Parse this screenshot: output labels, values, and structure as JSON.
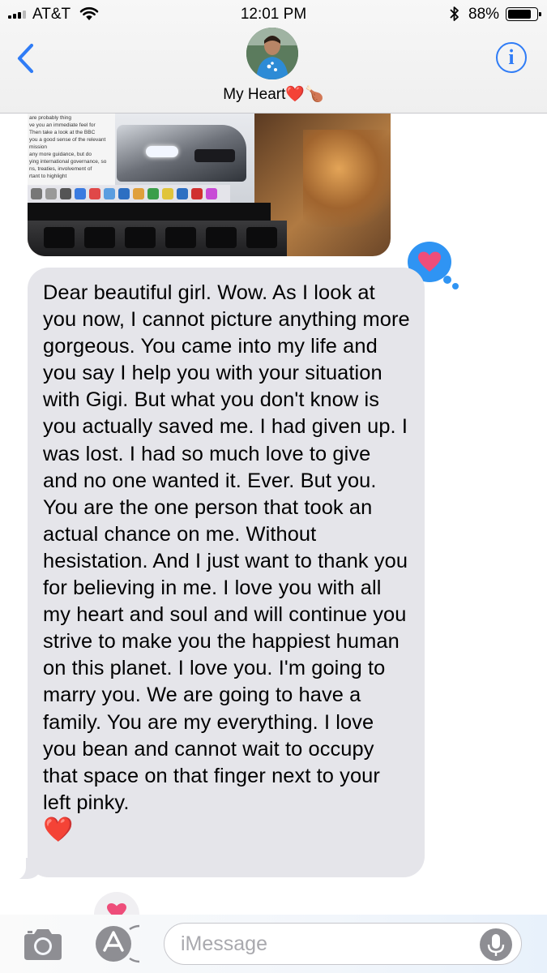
{
  "status_bar": {
    "carrier": "AT&T",
    "time": "12:01 PM",
    "battery_percent": "88%",
    "battery_level": 0.88,
    "signal_bars_filled": 3,
    "signal_bars_total": 4
  },
  "nav": {
    "contact_name": "My Heart",
    "contact_name_emoji": "❤️🍗",
    "back_icon": "chevron-left-icon",
    "info_icon": "info-icon"
  },
  "conversation": {
    "message_text": "Dear beautiful girl. Wow. As I look at you now, I cannot picture anything more gorgeous. You came into my life and you say I help you with your situation with Gigi. But what you don't know is you actually saved me. I had given up. I was lost. I had so much love to give and no one wanted it. Ever. But you. You are the one person that took an actual chance on me. Without hesistation. And I just want to thank you for believing in me. I love you with all my heart and soul and will continue you strive to make you the happiest human on this planet. I love you. I'm going to marry you. We are going to have a family. You are my everything. I love you bean and cannot wait to occupy that space on that finger next to your left pinky.",
    "message_emoji": "❤️",
    "photo_doc_text": [
      "are probably thing",
      "ve you an immediate feel for",
      "Then take a look at the BBC",
      "you a good sense of the relevant",
      "mission",
      "any more guidance, but do",
      "ying international governance, so",
      "ns, treaties, involvement of",
      "rtant to highlight"
    ],
    "tapback_icon": "heart-icon"
  },
  "input_bar": {
    "placeholder": "iMessage",
    "camera_icon": "camera-icon",
    "appstore_icon": "app-store-icon",
    "mic_icon": "microphone-icon"
  },
  "colors": {
    "accent_blue": "#2f7cf6",
    "tapback_blue": "#2f94f3",
    "heart_pink": "#ee4d7a",
    "bubble_gray": "#e5e5ea"
  }
}
